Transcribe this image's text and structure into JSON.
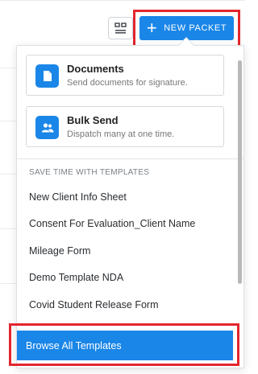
{
  "toolbar": {
    "grid_toggle_icon": "grid-list-icon",
    "new_packet_label": "NEW PACKET",
    "new_packet_icon": "plus-icon"
  },
  "dropdown": {
    "cards": [
      {
        "title": "Documents",
        "subtitle": "Send documents for signature.",
        "icon": "document-icon"
      },
      {
        "title": "Bulk Send",
        "subtitle": "Dispatch many at one time.",
        "icon": "people-icon"
      }
    ],
    "templates_section_label": "SAVE TIME WITH TEMPLATES",
    "templates": [
      "New Client Info Sheet",
      "Consent For Evaluation_Client Name",
      "Mileage Form",
      "Demo Template NDA",
      "Covid Student Release Form"
    ],
    "browse_all_label": "Browse All Templates"
  },
  "colors": {
    "primary": "#1a86e8",
    "highlight_outline": "#e3262d"
  }
}
